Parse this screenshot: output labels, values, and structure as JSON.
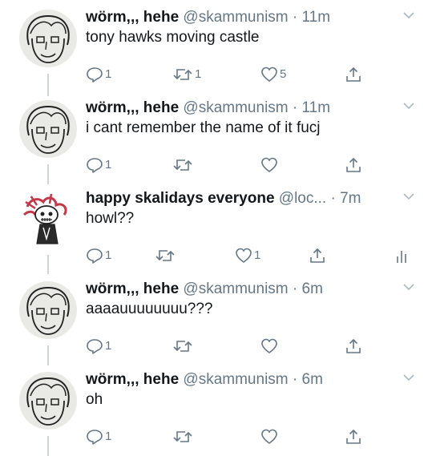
{
  "tweets": [
    {
      "display_name": "wörm,,, hehe",
      "handle": "@skammunism",
      "separator": "·",
      "time": "11m",
      "text": "tony hawks moving castle",
      "reply_count": "1",
      "retweet_count": "1",
      "like_count": "5",
      "avatar": "worm-avatar"
    },
    {
      "display_name": "wörm,,, hehe",
      "handle": "@skammunism",
      "separator": "·",
      "time": "11m",
      "text": "i cant remember the name of it fucj",
      "reply_count": "1",
      "retweet_count": "",
      "like_count": "",
      "avatar": "worm-avatar"
    },
    {
      "display_name": "happy skalidays everyone",
      "handle": "@loc...",
      "separator": "·",
      "time": "7m",
      "text": "howl??",
      "reply_count": "1",
      "retweet_count": "",
      "like_count": "1",
      "avatar": "skull-avatar"
    },
    {
      "display_name": "wörm,,, hehe",
      "handle": "@skammunism",
      "separator": "·",
      "time": "6m",
      "text": "aaaauuuuuuuu???",
      "reply_count": "1",
      "retweet_count": "",
      "like_count": "",
      "avatar": "worm-avatar"
    },
    {
      "display_name": "wörm,,, hehe",
      "handle": "@skammunism",
      "separator": "·",
      "time": "6m",
      "text": "oh",
      "reply_count": "1",
      "retweet_count": "",
      "like_count": "",
      "avatar": "worm-avatar"
    }
  ],
  "icons": {
    "reply": "reply-icon",
    "retweet": "retweet-icon",
    "like": "heart-icon",
    "share": "share-icon",
    "caret": "chevron-down-icon",
    "analytics": "analytics-icon"
  },
  "colors": {
    "text": "#14171a",
    "secondary": "#657786",
    "thread_line": "#cfd4d9"
  }
}
